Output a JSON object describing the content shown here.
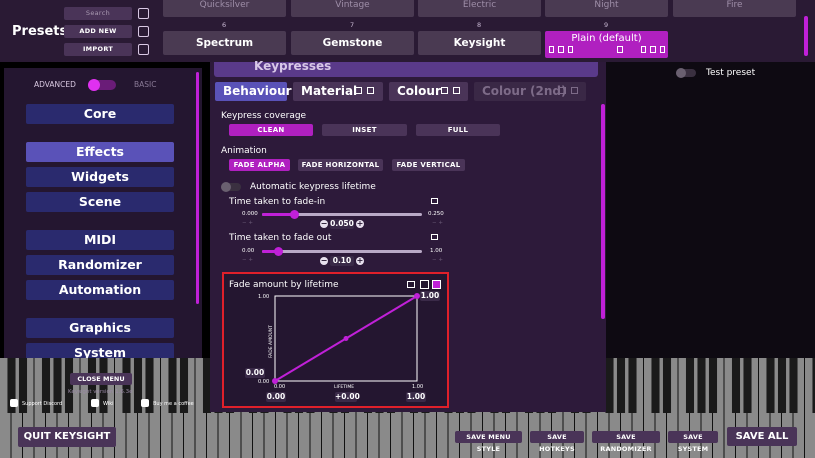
{
  "colors": {
    "accent": "#c020d8",
    "highlight_frame": "#e0202a",
    "nav_active": "#5a52b8",
    "nav": "#2a2a6e"
  },
  "presets": {
    "title": "Presets",
    "search_placeholder": "Search",
    "add_new": "ADD NEW",
    "import": "IMPORT",
    "top_row": [
      "Quicksilver",
      "Vintage",
      "Electric",
      "Night",
      "Fire"
    ],
    "numbers": [
      "6",
      "7",
      "8",
      "9"
    ],
    "tiles": [
      "Spectrum",
      "Gemstone",
      "Keysight",
      "Plain (default)"
    ]
  },
  "left": {
    "advanced": "ADVANCED",
    "basic": "BASIC",
    "nav": [
      "Core",
      "Effects",
      "Widgets",
      "Scene",
      "MIDI",
      "Randomizer",
      "Automation",
      "Graphics",
      "System"
    ],
    "close_menu": "CLOSE MENU",
    "version": "Keysight version 1.6.3e",
    "support": "Support Discord",
    "wiki": "Wiki",
    "coffee": "Buy me a coffee"
  },
  "center": {
    "header": "Keypresses",
    "tabs": [
      "Behaviour",
      "Material",
      "Colour",
      "Colour (2nd)"
    ],
    "coverage_label": "Keypress coverage",
    "coverage_options": [
      "CLEAN",
      "INSET",
      "FULL"
    ],
    "animation_label": "Animation",
    "animation_options": [
      "FADE ALPHA",
      "FADE HORIZONTAL",
      "FADE VERTICAL"
    ],
    "auto_lifetime": "Automatic keypress lifetime",
    "fade_in": {
      "label": "Time taken to fade-in",
      "min": "0.000",
      "max": "0.250",
      "value": "0.050",
      "fraction": 0.2
    },
    "fade_out": {
      "label": "Time taken to fade out",
      "min": "0.00",
      "max": "1.00",
      "value": "0.10",
      "fraction": 0.1
    },
    "graph": {
      "title": "Fade amount by lifetime",
      "y_axis": "FADE AMOUNT",
      "x_axis": "LIFETIME",
      "y_top": "1.00",
      "y_bottom": "0.00",
      "x_left": "0.00",
      "x_right": "1.00",
      "start_value": "0.00",
      "end_value": "1.00",
      "mid_value": "+0.00",
      "bottom_left": "0.00",
      "bottom_right": "1.00"
    }
  },
  "right": {
    "test_preset": "Test preset"
  },
  "bottom": {
    "quit": "QUIT KEYSIGHT",
    "buttons": [
      "SAVE MENU STYLE",
      "SAVE HOTKEYS",
      "SAVE RANDOMIZER",
      "SAVE SYSTEM"
    ],
    "save_all": "SAVE ALL"
  }
}
